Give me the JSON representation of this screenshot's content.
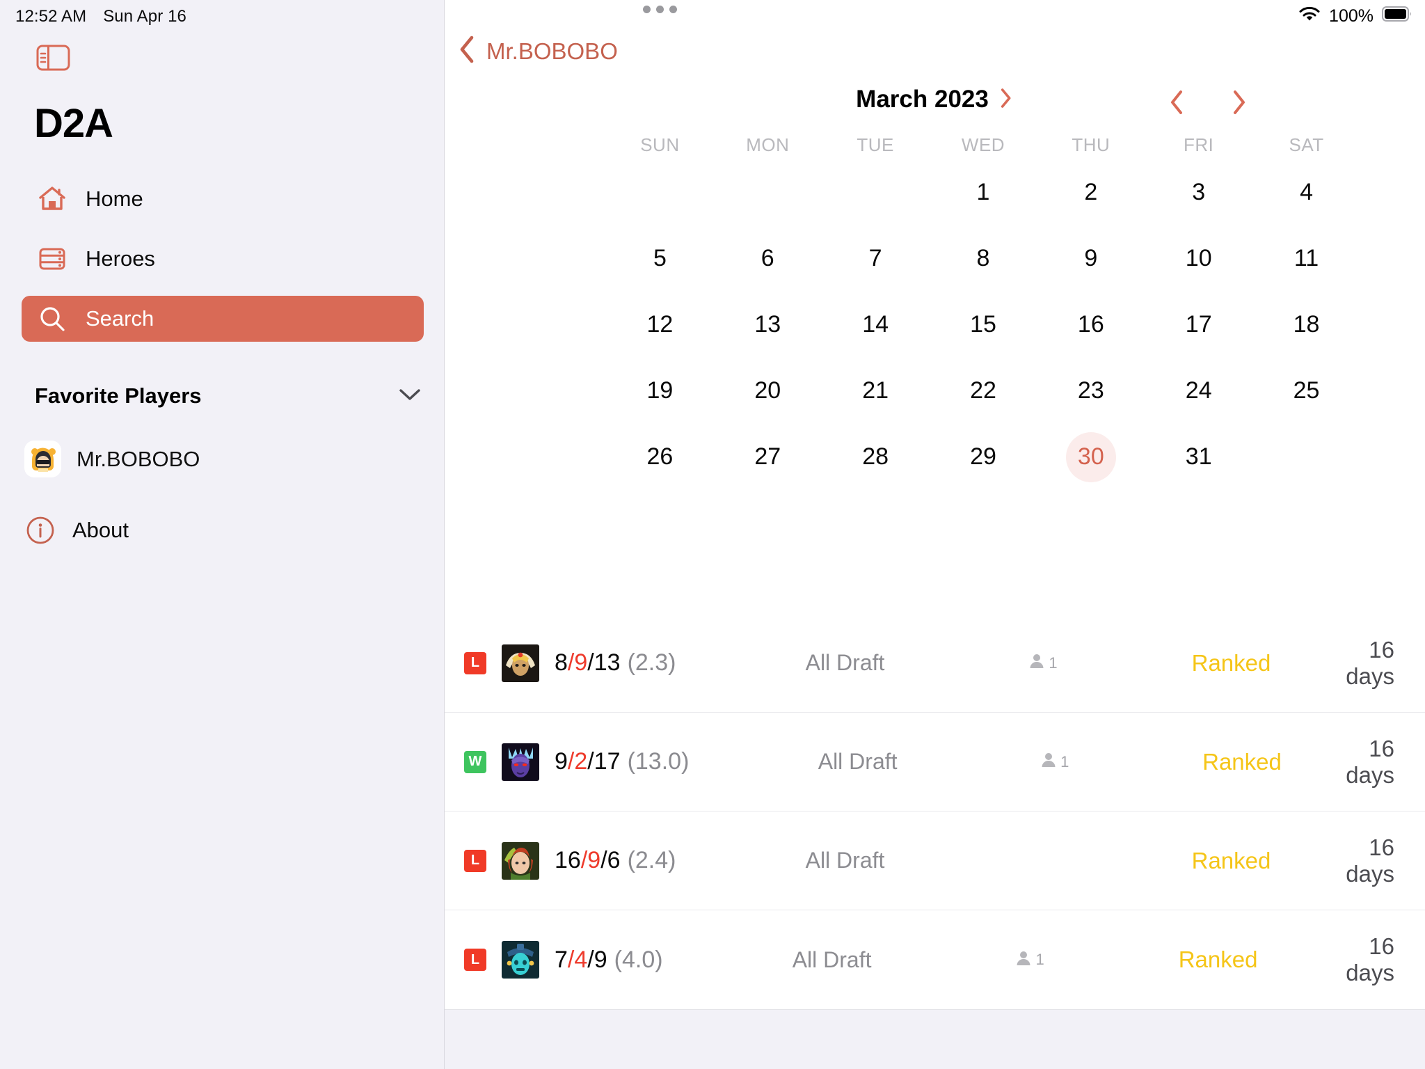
{
  "status_bar": {
    "time": "12:52 AM",
    "date": "Sun Apr 16",
    "battery_percent": "100%",
    "wifi_icon": "wifi-icon",
    "battery_icon": "battery-full-icon"
  },
  "sidebar": {
    "toggle_icon": "sidebar-toggle-icon",
    "app_title": "D2A",
    "nav_items": [
      {
        "label": "Home",
        "icon": "home-icon",
        "active": false
      },
      {
        "label": "Heroes",
        "icon": "server-rack-icon",
        "active": false
      },
      {
        "label": "Search",
        "icon": "search-icon",
        "active": true
      }
    ],
    "favorites": {
      "title": "Favorite Players",
      "collapse_icon": "chevron-down-icon",
      "players": [
        {
          "name": "Mr.BOBOBO",
          "avatar": "player-avatar"
        }
      ]
    },
    "about": {
      "label": "About",
      "icon": "info-circle-icon"
    }
  },
  "main": {
    "grabber_icon": "window-grabber-icon",
    "back_nav": {
      "label": "Mr.BOBOBO",
      "icon": "chevron-left-icon"
    },
    "calendar": {
      "month_label": "March 2023",
      "month_picker_icon": "chevron-right-icon",
      "prev_icon": "chevron-left-icon",
      "next_icon": "chevron-right-icon",
      "weekdays": [
        "SUN",
        "MON",
        "TUE",
        "WED",
        "THU",
        "FRI",
        "SAT"
      ],
      "weeks": [
        [
          "",
          "",
          "",
          "1",
          "2",
          "3",
          "4"
        ],
        [
          "5",
          "6",
          "7",
          "8",
          "9",
          "10",
          "11"
        ],
        [
          "12",
          "13",
          "14",
          "15",
          "16",
          "17",
          "18"
        ],
        [
          "19",
          "20",
          "21",
          "22",
          "23",
          "24",
          "25"
        ],
        [
          "26",
          "27",
          "28",
          "29",
          "30",
          "31",
          ""
        ]
      ],
      "selected_day": "30"
    },
    "matches": [
      {
        "result": "L",
        "hero": "hero-portrait-skywrath",
        "kills": "8",
        "deaths": "9",
        "assists": "13",
        "kda_ratio": "(2.3)",
        "mode": "All Draft",
        "party_icon": "person-icon",
        "party_size": "1",
        "lobby": "Ranked",
        "time_ago": "16 days"
      },
      {
        "result": "W",
        "hero": "hero-portrait-night-stalker",
        "kills": "9",
        "deaths": "2",
        "assists": "17",
        "kda_ratio": "(13.0)",
        "mode": "All Draft",
        "party_icon": "person-icon",
        "party_size": "1",
        "lobby": "Ranked",
        "time_ago": "16 days"
      },
      {
        "result": "L",
        "hero": "hero-portrait-windranger",
        "kills": "16",
        "deaths": "9",
        "assists": "6",
        "kda_ratio": "(2.4)",
        "mode": "All Draft",
        "party_icon": "",
        "party_size": "",
        "lobby": "Ranked",
        "time_ago": "16 days"
      },
      {
        "result": "L",
        "hero": "hero-portrait-storm-spirit",
        "kills": "7",
        "deaths": "4",
        "assists": "9",
        "kda_ratio": "(4.0)",
        "mode": "All Draft",
        "party_icon": "person-icon",
        "party_size": "1",
        "lobby": "Ranked",
        "time_ago": "16 days"
      }
    ]
  },
  "colors": {
    "accent": "#d96a56",
    "accent_text": "#c4614e",
    "sidebar_bg": "#f2f1f7",
    "win": "#3ec45e",
    "loss": "#f03a27",
    "lobby": "#f5c518",
    "selected_day_bg": "#fbeceb"
  }
}
